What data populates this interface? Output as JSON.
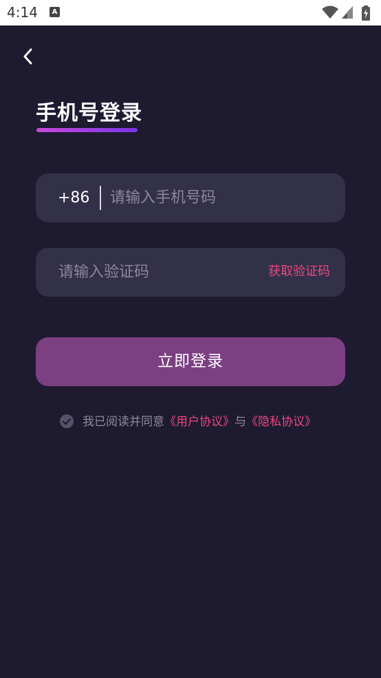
{
  "status_bar": {
    "time": "4:14",
    "notification_icon_letter": "A",
    "icons": [
      "wifi-icon",
      "signal-icon",
      "battery-icon"
    ]
  },
  "header": {
    "back_icon": "chevron-left-icon",
    "title": "手机号登录"
  },
  "phone_field": {
    "country_code": "+86",
    "placeholder": "请输入手机号码",
    "value": ""
  },
  "code_field": {
    "placeholder": "请输入验证码",
    "value": "",
    "get_code_label": "获取验证码"
  },
  "login_button": {
    "label": "立即登录"
  },
  "agreement": {
    "checked": true,
    "prefix": "我已阅读并同意",
    "user_agreement": "《用户协议》",
    "conjunction": "与",
    "privacy_policy": "《隐私协议》"
  },
  "colors": {
    "background": "#1e1a30",
    "field_background": "#33304a",
    "button_background": "#7c3f82",
    "accent": "#e8497e",
    "title_underline_start": "#c94bd8",
    "title_underline_end": "#7a35e8"
  }
}
